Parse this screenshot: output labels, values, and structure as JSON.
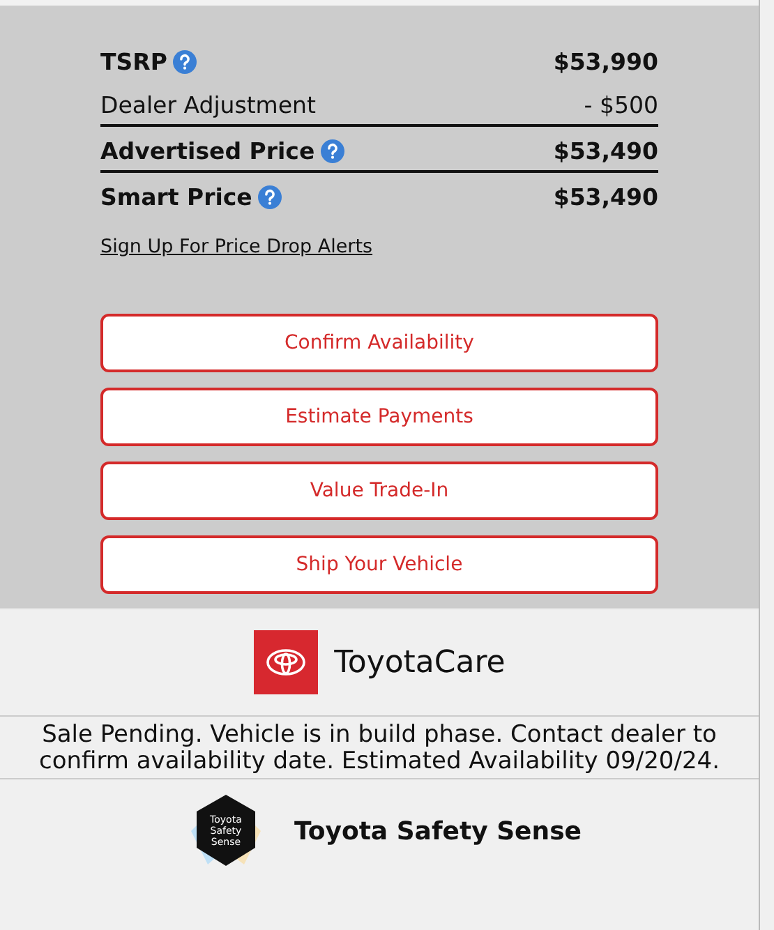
{
  "prices": [
    {
      "label": "TSRP",
      "value": "$53,990",
      "kind": "bold",
      "help": true,
      "rule_below": false
    },
    {
      "label": "Dealer Adjustment",
      "value": "- $500",
      "kind": "plain",
      "help": false,
      "rule_below": true
    },
    {
      "label": "Advertised Price",
      "value": "$53,490",
      "kind": "bold",
      "help": true,
      "rule_below": true
    },
    {
      "label": "Smart Price",
      "value": "$53,490",
      "kind": "bold",
      "help": true,
      "rule_below": false
    }
  ],
  "alert_link": "Sign Up For Price Drop Alerts",
  "buttons": [
    "Confirm Availability",
    "Estimate Payments",
    "Value Trade-In",
    "Ship Your Vehicle"
  ],
  "toyotacare": {
    "name": "ToyotaCare"
  },
  "status_message": "Sale Pending. Vehicle is in build phase. Contact dealer to confirm availability date. Estimated Availability 09/20/24.",
  "safety_sense": {
    "badge_lines": [
      "Toyota",
      "Safety",
      "Sense"
    ],
    "name": "Toyota Safety Sense"
  }
}
